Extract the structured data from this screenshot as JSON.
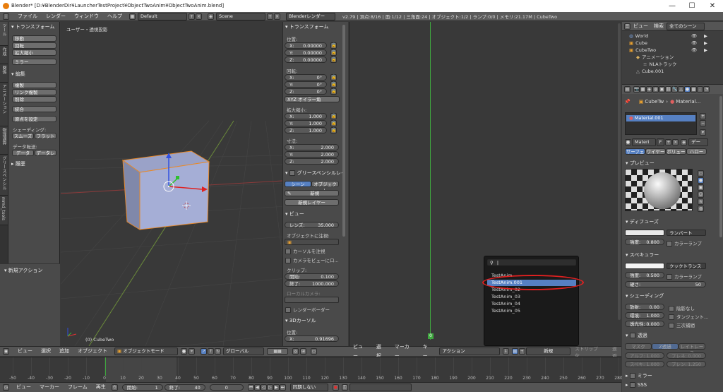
{
  "titlebar": {
    "title": "Blender* [D:¥BlenderDir¥LauncherTestProject¥ObjectTwoAnim¥ObjectTwoAnim.blend]",
    "minimize": "—",
    "maximize": "☐",
    "close": "✕"
  },
  "infobar": {
    "menus": [
      "ファイル",
      "レンダー",
      "ウィンドウ",
      "ヘルプ"
    ],
    "layout": "Default",
    "scene": "Scene",
    "engine": "Blenderレンダー",
    "stats": "v2.79 | 頂点:8/16 | 面:1/12 | 三角面:24 | オブジェクト:1/2 | ランプ:0/0 | メモリ:21.17M | CubeTwo"
  },
  "tool_tabs": [
    "ツール",
    "作成",
    "関係",
    "アニメーション",
    "物理演算",
    "グリースペンシル",
    "mmd_tools"
  ],
  "tool_shelf": {
    "transform_header": "▾ トランスフォーム",
    "transform_buttons": [
      "移動",
      "回転",
      "拡大縮小"
    ],
    "mirror": "ミラー",
    "edit_header": "▾ 編集",
    "edit_buttons": [
      "複製",
      "リンク複製",
      "削除"
    ],
    "join": "統合",
    "set_origin": "原点を設定",
    "shading_label": "シェーディング:",
    "smooth": "スムーズ",
    "flat": "フラット",
    "data_transfer_label": "データ転送:",
    "data": "データ",
    "data_layer": "データレ",
    "history": "▸ 履歴",
    "new_action_header": "▾ 新規アクション"
  },
  "viewport": {
    "label": "ユーザー・透視投影",
    "object_label": "(0) CubeTwo"
  },
  "properties": {
    "transform_header": "▾ トランスフォーム",
    "location_label": "位置:",
    "location": [
      {
        "axis": "X:",
        "value": "0.00000"
      },
      {
        "axis": "Y:",
        "value": "0.00000"
      },
      {
        "axis": "Z:",
        "value": "0.00000"
      }
    ],
    "rotation_label": "回転:",
    "rotation": [
      {
        "axis": "X:",
        "value": "0°"
      },
      {
        "axis": "Y:",
        "value": "0°"
      },
      {
        "axis": "Z:",
        "value": "0°"
      }
    ],
    "rotation_mode": "XYZ オイラー角",
    "scale_label": "拡大縮小:",
    "scale": [
      {
        "axis": "X:",
        "value": "1.000"
      },
      {
        "axis": "Y:",
        "value": "1.000"
      },
      {
        "axis": "Z:",
        "value": "1.000"
      }
    ],
    "dims_label": "寸法:",
    "dims": [
      {
        "axis": "X:",
        "value": "2.000"
      },
      {
        "axis": "Y:",
        "value": "2.000"
      },
      {
        "axis": "Z:",
        "value": "2.000"
      }
    ],
    "grease_header": "グリースペンシルレイ",
    "scene_btn": "シーン",
    "object_btn": "オブジェクト",
    "new_btn": "新規",
    "new_layer_btn": "新規レイヤー",
    "view_header": "▾ ビュー",
    "lens_label": "レンズ:",
    "lens_value": "35.000",
    "lock_label": "オブジェクトに注視:",
    "lock_cursor": "カーソルを注視",
    "lock_camera": "カメラをビューにロ...",
    "clip_label": "クリップ:",
    "clip_start_label": "開始:",
    "clip_start": "0.100",
    "clip_end_label": "終了:",
    "clip_end": "1000.000",
    "local_camera": "ローカルカメラ:",
    "render_border": "レンダーボーダー",
    "cursor_header": "▾ 3Dカーソル",
    "cursor_loc_label": "位置:",
    "cursor_x_label": "X:",
    "cursor_x": "0.91696"
  },
  "header3d": {
    "view": "ビュー",
    "select": "選択",
    "add": "追加",
    "object": "オブジェクト",
    "mode": "オブジェクトモード",
    "orientation": "グローバル"
  },
  "dopesheet": {
    "frame_marker": "0",
    "view": "ビュー",
    "select": "選択",
    "marker": "マーカー",
    "key": "キー",
    "action_mode": "アクション",
    "new": "新規",
    "stash": "ストリップ化",
    "push": "退避"
  },
  "action_popup": {
    "search_cursor": "|",
    "items": [
      "TestAnim",
      "TestAnim.001",
      "TestAnim_02",
      "TestAnim_03",
      "TestAnim_04",
      "TestAnim_05"
    ],
    "selected_index": 1
  },
  "timeline": {
    "ticks": [
      "-50",
      "-40",
      "-30",
      "-20",
      "-10",
      "0",
      "10",
      "20",
      "30",
      "40",
      "50",
      "60",
      "70",
      "80",
      "90",
      "100",
      "110",
      "120",
      "130",
      "140",
      "150",
      "160",
      "170",
      "180",
      "190",
      "200",
      "210",
      "220",
      "230",
      "240",
      "250",
      "260",
      "270",
      "280"
    ],
    "view": "ビュー",
    "marker": "マーカー",
    "frame": "フレーム",
    "playback": "再生",
    "start_label": "開始:",
    "start": "1",
    "end_label": "終了:",
    "end": "40",
    "current": "0",
    "sync": "同期しない"
  },
  "outliner": {
    "view": "ビュー",
    "search": "検索",
    "filter": "全てのシーン",
    "items": [
      {
        "label": "World",
        "indent": 0
      },
      {
        "label": "Cube",
        "indent": 0
      },
      {
        "label": "CubeTwo",
        "indent": 0
      },
      {
        "label": "アニメーション",
        "indent": 1
      },
      {
        "label": "NLAトラック",
        "indent": 2
      },
      {
        "label": "Cube.001",
        "indent": 1
      }
    ]
  },
  "material": {
    "breadcrumb_obj": "CubeTw",
    "breadcrumb_mat": "Material...",
    "slot": "Material.001",
    "name_field": "Materi",
    "f_label": "F",
    "data_label": "デー",
    "tabs": [
      "サーフェ",
      "ワイヤー",
      "ボリュー",
      "ハロー"
    ],
    "preview_header": "▾ プレビュー",
    "diffuse_header": "▾ ディフューズ",
    "diffuse_shader": "ランバート",
    "intensity_label": "強度:",
    "diffuse_intensity": "0.800",
    "ramp": "カラーランプ",
    "specular_header": "▾ スペキュラー",
    "specular_shader": "クックトランス",
    "specular_intensity": "0.500",
    "hardness_label": "硬さ:",
    "hardness": "50",
    "shading_header": "▾ シェーディング",
    "emit_label": "放射:",
    "emit": "0.00",
    "ambient_label": "環境:",
    "ambient": "1.000",
    "translucency_label": "透光性:",
    "translucency": "0.000",
    "shadeless": "陰影なし",
    "tangent": "タンジェント...",
    "cubic": "三次補間",
    "transparency_header": "透過",
    "trans_modes": [
      "マスク",
      "Z透過",
      "レイトレース"
    ],
    "alpha_label": "アルフ:",
    "alpha": "1.000",
    "fresnel_label": "フレネ:",
    "fresnel": "0.000",
    "spec_label": "スペキ:",
    "spec": "1.000",
    "blend_label": "ブレン:",
    "blend": "1.250",
    "mirror_header": "ミラー",
    "sss_header": "SSS"
  },
  "colors": {
    "selected": "#5680c2",
    "highlight_ring": "#e02020",
    "playhead": "#3fa83f"
  }
}
